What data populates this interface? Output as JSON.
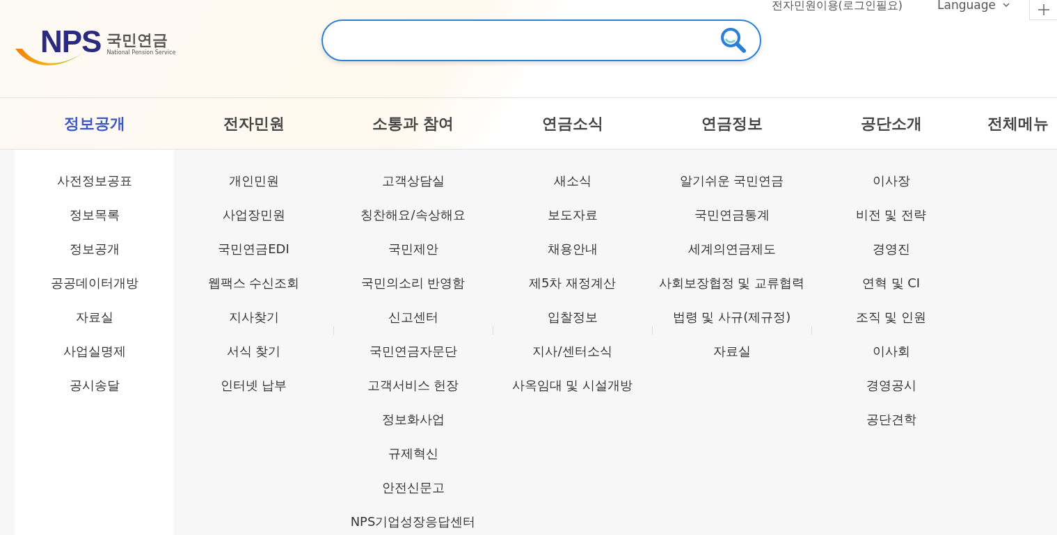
{
  "logo": {
    "mark": "NPS",
    "name": "국민연금",
    "subtitle": "National Pension Service"
  },
  "top_links": {
    "civil": "전자민원이용(로그인필요)",
    "language": "Language"
  },
  "nav": [
    {
      "label": "정보공개",
      "selected": true
    },
    {
      "label": "전자민원",
      "selected": false
    },
    {
      "label": "소통과 참여",
      "selected": false
    },
    {
      "label": "연금소식",
      "selected": false
    },
    {
      "label": "연금정보",
      "selected": false
    },
    {
      "label": "공단소개",
      "selected": false
    }
  ],
  "all_menu": "전체메뉴",
  "menu_columns": [
    {
      "items": [
        "사전정보공표",
        "정보목록",
        "정보공개",
        "공공데이터개방",
        "자료실",
        "사업실명제",
        "공시송달"
      ]
    },
    {
      "items": [
        "개인민원",
        "사업장민원",
        "국민연금EDI",
        "웹팩스 수신조회",
        "지사찾기",
        "서식 찾기",
        "인터넷 납부"
      ]
    },
    {
      "items": [
        "고객상담실",
        "칭찬해요/속상해요",
        "국민제안",
        "국민의소리 반영함",
        "신고센터",
        "국민연금자문단",
        "고객서비스 헌장",
        "정보화사업",
        "규제혁신",
        "안전신문고",
        "NPS기업성장응답센터"
      ]
    },
    {
      "items": [
        "새소식",
        "보도자료",
        "채용안내",
        "제5차 재정계산",
        "입찰정보",
        "지사/센터소식",
        "사옥임대 및 시설개방"
      ]
    },
    {
      "items": [
        "알기쉬운 국민연금",
        "국민연금통계",
        "세계의연금제도",
        "사회보장협정 및 교류협력",
        "법령 및 사규(제규정)",
        "자료실"
      ]
    },
    {
      "items": [
        "이사장",
        "비전 및 전략",
        "경영진",
        "연혁 및 CI",
        "조직 및 인원",
        "이사회",
        "경영공시",
        "공단견학"
      ]
    }
  ]
}
